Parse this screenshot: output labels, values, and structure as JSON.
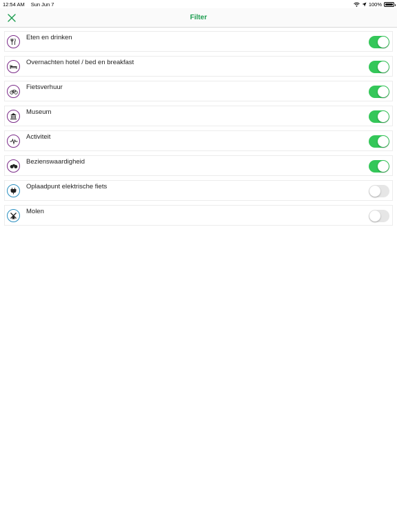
{
  "status_bar": {
    "time": "12:54 AM",
    "date": "Sun Jun 7",
    "battery": "100%"
  },
  "navbar": {
    "title": "Filter",
    "close_icon": "close-icon",
    "accent_color": "#1a9c4e"
  },
  "filters": [
    {
      "label": "Eten en drinken",
      "icon": "fork-knife-icon",
      "enabled": true
    },
    {
      "label": "Overnachten hotel / bed en breakfast",
      "icon": "bed-icon",
      "enabled": true
    },
    {
      "label": "Fietsverhuur",
      "icon": "bicycle-icon",
      "enabled": true
    },
    {
      "label": "Museum",
      "icon": "museum-icon",
      "enabled": true
    },
    {
      "label": "Activiteit",
      "icon": "activity-pulse-icon",
      "enabled": true
    },
    {
      "label": "Bezienswaardigheid",
      "icon": "binoculars-icon",
      "enabled": true
    },
    {
      "label": "Oplaadpunt elektrische fiets",
      "icon": "charging-plug-icon",
      "enabled": false
    },
    {
      "label": "Molen",
      "icon": "windmill-icon",
      "enabled": false
    }
  ],
  "colors": {
    "toggle_on": "#34c759",
    "toggle_off": "#e6e6e6",
    "icon_ring_purple": "#7a2a88",
    "icon_ring_blue": "#2a8fc0"
  }
}
